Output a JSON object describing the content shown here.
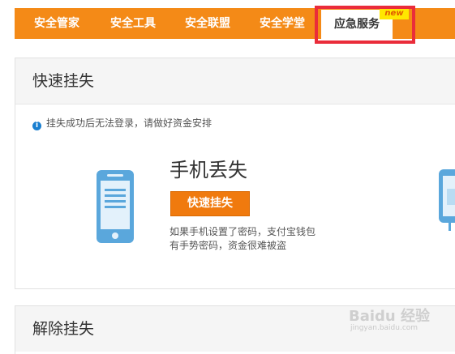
{
  "nav": {
    "items": [
      "安全管家",
      "安全工具",
      "安全联盟",
      "安全学堂",
      "应急服务"
    ],
    "badge": "new",
    "active_index": 4
  },
  "panel1": {
    "title": "快速挂失",
    "notice": "挂失成功后无法登录，请做好资金安排",
    "card_title": "手机丢失",
    "button": "快速挂失",
    "desc_lines": [
      "如果手机设置了密码，支付宝钱包",
      "有手势密码，资金很难被盗"
    ]
  },
  "panel2": {
    "title": "解除挂失"
  },
  "watermark": {
    "logo": "Baidu 经验",
    "url": "jingyan.baidu.com"
  },
  "colors": {
    "nav_bg": "#f48a17",
    "button_bg": "#f07a0e",
    "highlight": "#ea2c3a",
    "badge_bg": "#ffe800",
    "info_icon": "#1a7fd0",
    "phone_icon": "#5aa7dc"
  },
  "icons": [
    "info-icon",
    "phone-icon",
    "device-icon"
  ]
}
